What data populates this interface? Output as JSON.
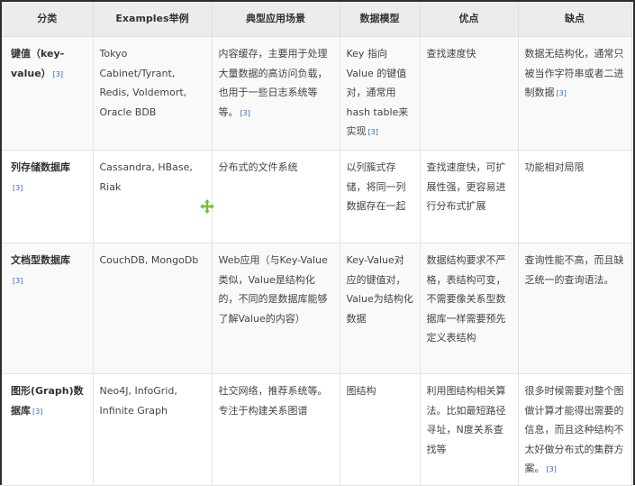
{
  "headers": [
    "分类",
    "Examples举例",
    "典型应用场景",
    "数据模型",
    "优点",
    "缺点"
  ],
  "rows": [
    {
      "type": "键值（key-value）",
      "examples": "Tokyo Cabinet/Tyrant, Redis, Voldemort, Oracle BDB",
      "scenario": "内容缓存，主要用于处理大量数据的高访问负载，也用于一些日志系统等等。",
      "scenario_ref": "[3]",
      "model": "Key 指向 Value 的键值对，通常用hash table来实现",
      "model_ref": "[3]",
      "pros": "查找速度快",
      "cons": "数据无结构化，通常只被当作字符串或者二进制数据",
      "cons_ref": "[3]",
      "type_ref": "[3]"
    },
    {
      "type": "列存储数据库",
      "type_ref": "[3]",
      "examples": "Cassandra, HBase, Riak",
      "scenario": "分布式的文件系统",
      "model": "以列簇式存储，将同一列数据存在一起",
      "pros": "查找速度快，可扩展性强，更容易进行分布式扩展",
      "cons": "功能相对局限"
    },
    {
      "type": "文档型数据库",
      "type_ref": "[3]",
      "examples": "CouchDB, MongoDb",
      "scenario": "Web应用（与Key-Value类似，Value是结构化的，不同的是数据库能够了解Value的内容）",
      "model": "Key-Value对应的键值对，Value为结构化数据",
      "pros": "数据结构要求不严格，表结构可变，不需要像关系型数据库一样需要预先定义表结构",
      "cons": "查询性能不高，而且缺乏统一的查询语法。"
    },
    {
      "type": "图形(Graph)数据库",
      "type_ref": "[3]",
      "examples": "Neo4J, InfoGrid, Infinite Graph",
      "scenario": "社交网络，推荐系统等。专注于构建关系图谱",
      "model": "图结构",
      "pros": "利用图结构相关算法。比如最短路径寻址，N度关系查找等",
      "cons": "很多时候需要对整个图做计算才能得出需要的信息，而且这种结构不太好做分布式的集群方案。",
      "cons_ref": "[3]"
    }
  ],
  "colors": {
    "header_bg": "#ececec",
    "ref": "#3366cc",
    "cursor": "#6fbf3f"
  },
  "cursor_icon": "move-cursor"
}
